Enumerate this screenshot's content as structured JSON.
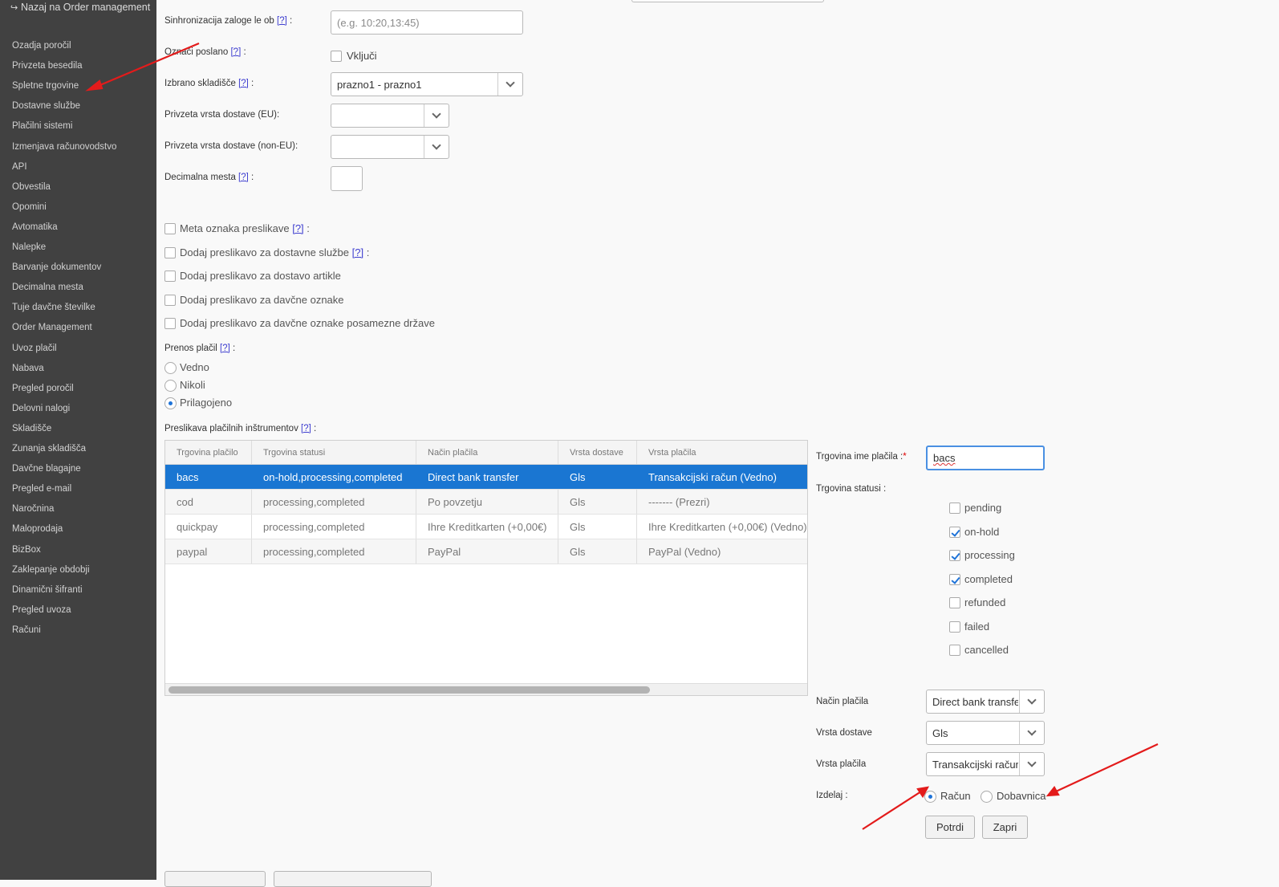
{
  "sidebar": {
    "back_label": "Nazaj na Order management",
    "items": [
      "Ozadja poročil",
      "Privzeta besedila",
      "Spletne trgovine",
      "Dostavne službe",
      "Plačilni sistemi",
      "Izmenjava računovodstvo",
      "API",
      "Obvestila",
      "Opomini",
      "Avtomatika",
      "Nalepke",
      "Barvanje dokumentov",
      "Decimalna mesta",
      "Tuje davčne številke",
      "Order Management",
      "Uvoz plačil",
      "Nabava",
      "Pregled poročil",
      "Delovni nalogi",
      "Skladišče",
      "Zunanja skladišča",
      "Davčne blagajne",
      "Pregled e-mail",
      "Naročnina",
      "Maloprodaja",
      "BizBox",
      "Zaklepanje obdobji",
      "Dinamični šifranti",
      "Pregled uvoza",
      "Računi"
    ]
  },
  "form": {
    "help": "[?]",
    "sync_label": "Sinhronizacija zaloge le ob",
    "sync_placeholder": "(e.g. 10:20,13:45)",
    "mark_sent_label": "Označi poslano",
    "mark_sent_option": "Vključi",
    "warehouse_label": "Izbrano skladišče",
    "warehouse_value": "prazno1 - prazno1",
    "ship_eu_label": "Privzeta vrsta dostave (EU):",
    "ship_noneu_label": "Privzeta vrsta dostave (non-EU):",
    "decimals_label": "Decimalna mesta",
    "checkboxes": [
      "Meta oznaka preslikave",
      "Dodaj preslikavo za dostavne službe",
      "Dodaj preslikavo za dostavo artikle",
      "Dodaj preslikavo za davčne oznake",
      "Dodaj preslikavo za davčne oznake posamezne države"
    ],
    "payment_transfer_label": "Prenos plačil",
    "payment_transfer_options": [
      "Vedno",
      "Nikoli",
      "Prilagojeno"
    ],
    "payment_transfer_selected": "Prilagojeno",
    "mapping_label": "Preslikava plačilnih inštrumentov"
  },
  "table": {
    "columns": [
      "Trgovina plačilo",
      "Trgovina statusi",
      "Način plačila",
      "Vrsta dostave",
      "Vrsta plačila"
    ],
    "rows": [
      [
        "bacs",
        "on-hold,processing,completed",
        "Direct bank transfer",
        "Gls",
        "Transakcijski račun (Vedno)"
      ],
      [
        "cod",
        "processing,completed",
        "Po povzetju",
        "Gls",
        "------- (Prezri)"
      ],
      [
        "quickpay",
        "processing,completed",
        "Ihre Kreditkarten (+0,00€)",
        "Gls",
        "Ihre Kreditkarten (+0,00€) (Vedno)"
      ],
      [
        "paypal",
        "processing,completed",
        "PayPal",
        "Gls",
        "PayPal (Vedno)"
      ]
    ],
    "selected_row": 0
  },
  "editor": {
    "shop_payment_name_label": "Trgovina ime plačila :",
    "shop_payment_name_value": "bacs",
    "shop_statuses_label": "Trgovina statusi :",
    "statuses": [
      {
        "name": "pending",
        "checked": false
      },
      {
        "name": "on-hold",
        "checked": true
      },
      {
        "name": "processing",
        "checked": true
      },
      {
        "name": "completed",
        "checked": true
      },
      {
        "name": "refunded",
        "checked": false
      },
      {
        "name": "failed",
        "checked": false
      },
      {
        "name": "cancelled",
        "checked": false
      }
    ],
    "payment_method_label": "Način plačila",
    "payment_method_value": "Direct bank transfer",
    "delivery_type_label": "Vrsta dostave",
    "delivery_type_value": "Gls",
    "payment_type_label": "Vrsta plačila",
    "payment_type_value": "Transakcijski račun",
    "produce_label": "Izdelaj :",
    "produce_options": [
      "Račun",
      "Dobavnica"
    ],
    "produce_selected": "Račun",
    "confirm_label": "Potrdi",
    "close_label": "Zapri"
  },
  "colors": {
    "sidebar_bg": "#414141",
    "selection": "#1a76d2",
    "annotation_arrow": "#e31b1b"
  }
}
